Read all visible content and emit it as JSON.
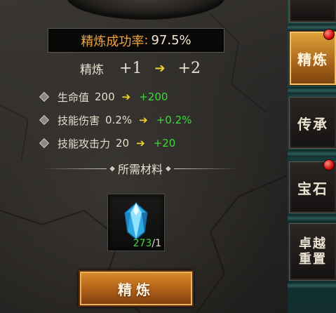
{
  "refine": {
    "rate_label": "精炼成功率",
    "rate_sep": ":",
    "rate_value": "97.5%",
    "level_title": "精炼",
    "level_from": "+1",
    "level_to": "+2"
  },
  "attributes": [
    {
      "name": "生命值",
      "current": "200",
      "next": "+200"
    },
    {
      "name": "技能伤害",
      "current": "0.2%",
      "next": "+0.2%"
    },
    {
      "name": "技能攻击力",
      "current": "20",
      "next": "+20"
    }
  ],
  "materials": {
    "title": "所需材料",
    "item": {
      "icon": "blue-crystal-icon",
      "have": "273",
      "sep": "/",
      "need": "1"
    }
  },
  "button": {
    "label": "精炼"
  },
  "sidebar": {
    "tabs": [
      {
        "label": "精炼",
        "active": true,
        "badge": true
      },
      {
        "label": "传承",
        "active": false,
        "badge": false
      },
      {
        "label": "宝石",
        "active": false,
        "badge": true
      },
      {
        "label_line1": "卓越",
        "label_line2": "重置",
        "active": false,
        "badge": false
      }
    ]
  },
  "colors": {
    "rate_label": "#f0a640",
    "increase": "#3fd83a",
    "arrow": "#f2d22a",
    "button": "#b8661a",
    "badge": "#d01010"
  }
}
